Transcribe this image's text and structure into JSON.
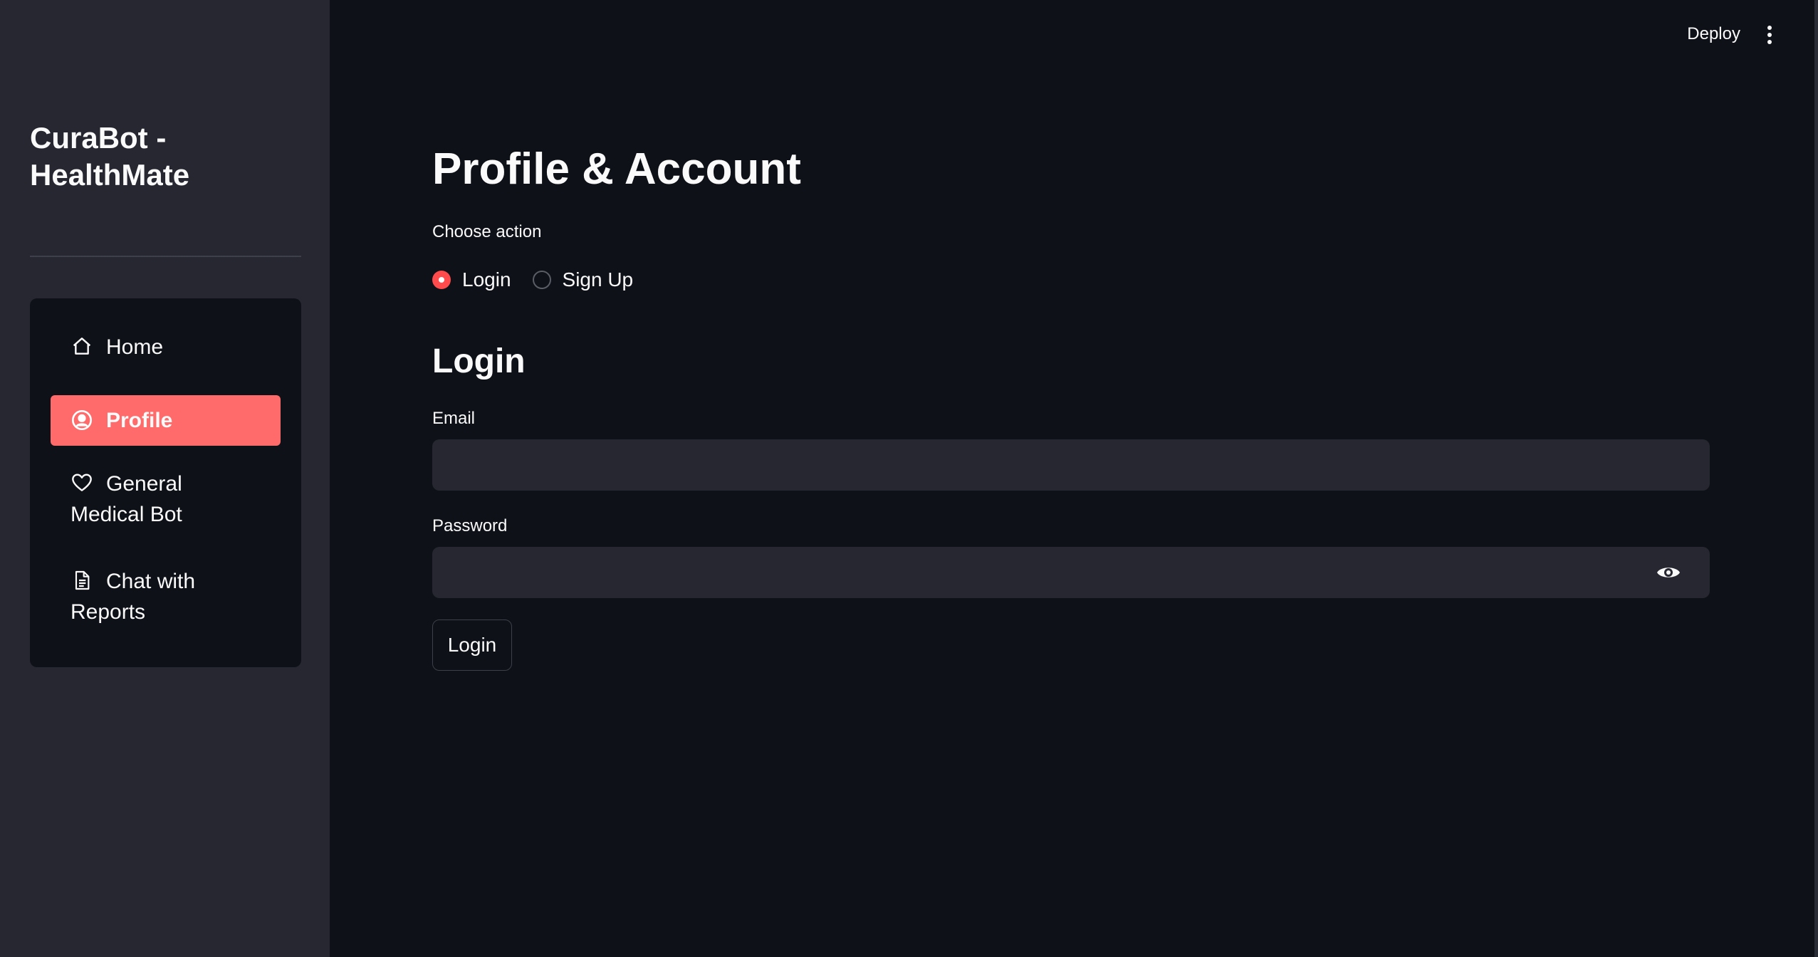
{
  "sidebar": {
    "title": "CuraBot - HealthMate",
    "nav": [
      {
        "label": "Home",
        "icon": "home-icon",
        "active": false
      },
      {
        "label": "Profile",
        "icon": "user-circle-icon",
        "active": true
      },
      {
        "label": "General Medical Bot",
        "icon": "heart-icon",
        "active": false
      },
      {
        "label": "Chat with Reports",
        "icon": "document-icon",
        "active": false
      }
    ]
  },
  "header": {
    "deploy_label": "Deploy",
    "menu_icon": "vertical-dots-icon"
  },
  "main": {
    "title": "Profile & Account",
    "action_label": "Choose action",
    "actions": [
      {
        "label": "Login",
        "checked": true
      },
      {
        "label": "Sign Up",
        "checked": false
      }
    ],
    "section_title": "Login",
    "email": {
      "label": "Email",
      "value": "",
      "placeholder": ""
    },
    "password": {
      "label": "Password",
      "value": "",
      "placeholder": ""
    },
    "submit_label": "Login"
  },
  "colors": {
    "accent": "#ff4b4b",
    "active_nav": "#ff6b6b",
    "background": "#0e1117",
    "sidebar": "#262730"
  }
}
